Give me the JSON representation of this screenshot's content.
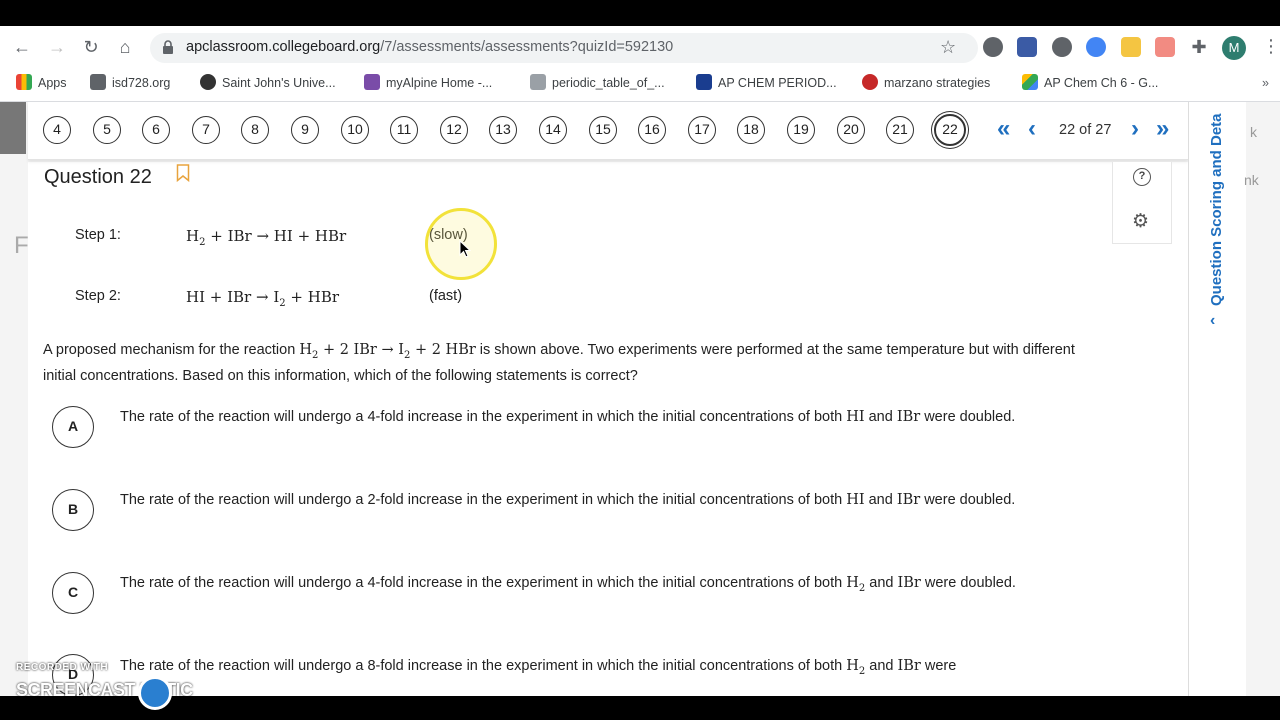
{
  "browser": {
    "url_host": "apclassroom.collegeboard.org",
    "url_path": "/7/assessments/assessments?quizId=592130",
    "avatar_letter": "M",
    "bookmarks": [
      {
        "label": "Apps"
      },
      {
        "label": "isd728.org"
      },
      {
        "label": "Saint John's Unive..."
      },
      {
        "label": "myAlpine Home -..."
      },
      {
        "label": "periodic_table_of_..."
      },
      {
        "label": "AP CHEM PERIOD..."
      },
      {
        "label": "marzano strategies"
      },
      {
        "label": "AP Chem Ch 6 - G..."
      }
    ]
  },
  "question_nav": {
    "numbers": [
      "4",
      "5",
      "6",
      "7",
      "8",
      "9",
      "10",
      "11",
      "12",
      "13",
      "14",
      "15",
      "16",
      "17",
      "18",
      "19",
      "20",
      "21",
      "22"
    ],
    "active": "22",
    "count_label": "22 of 27"
  },
  "question": {
    "title": "Question 22",
    "steps": [
      {
        "label": "Step 1:",
        "rate": "(slow)"
      },
      {
        "label": "Step 2:",
        "rate": "(fast)"
      }
    ],
    "stem_before": "A proposed mechanism for the reaction ",
    "stem_after": " is shown above. Two experiments were performed at the same temperature but with different initial concentrations. Based on this information, which of the following statements is correct?",
    "options": [
      {
        "letter": "A",
        "before": "The rate of the reaction will undergo a 4-fold increase in the experiment in which the initial concentrations of both ",
        "sp1": "HI",
        "mid": " and ",
        "sp2": "IBr",
        "after": " were doubled."
      },
      {
        "letter": "B",
        "before": "The rate of the reaction will undergo a 2-fold increase in the experiment in which the initial concentrations of both ",
        "sp1": "HI",
        "mid": " and ",
        "sp2": "IBr",
        "after": " were doubled."
      },
      {
        "letter": "C",
        "before": "The rate of the reaction will undergo a 4-fold increase in the experiment in which the initial concentrations of both ",
        "sp1": "H2",
        "mid": " and ",
        "sp2": "IBr",
        "after": " were doubled."
      },
      {
        "letter": "D",
        "before": "The rate of the reaction will undergo a 8-fold increase in the experiment in which the initial concentrations of both ",
        "sp1": "H2",
        "mid": " and ",
        "sp2": "IBr",
        "after": " were"
      }
    ]
  },
  "sidebar": {
    "label": "Question Scoring and Deta",
    "far_text_1": "k",
    "far_text_2": "nk",
    "left_letter": "F"
  },
  "watermark": {
    "top": "RECORDED WITH",
    "bottom": "SCREENCAST    MATIC"
  },
  "colors": {
    "accent": "#1f6fbf",
    "bookmark_flag": "#e8a33d",
    "cursor_highlight": "#f2e23a"
  }
}
